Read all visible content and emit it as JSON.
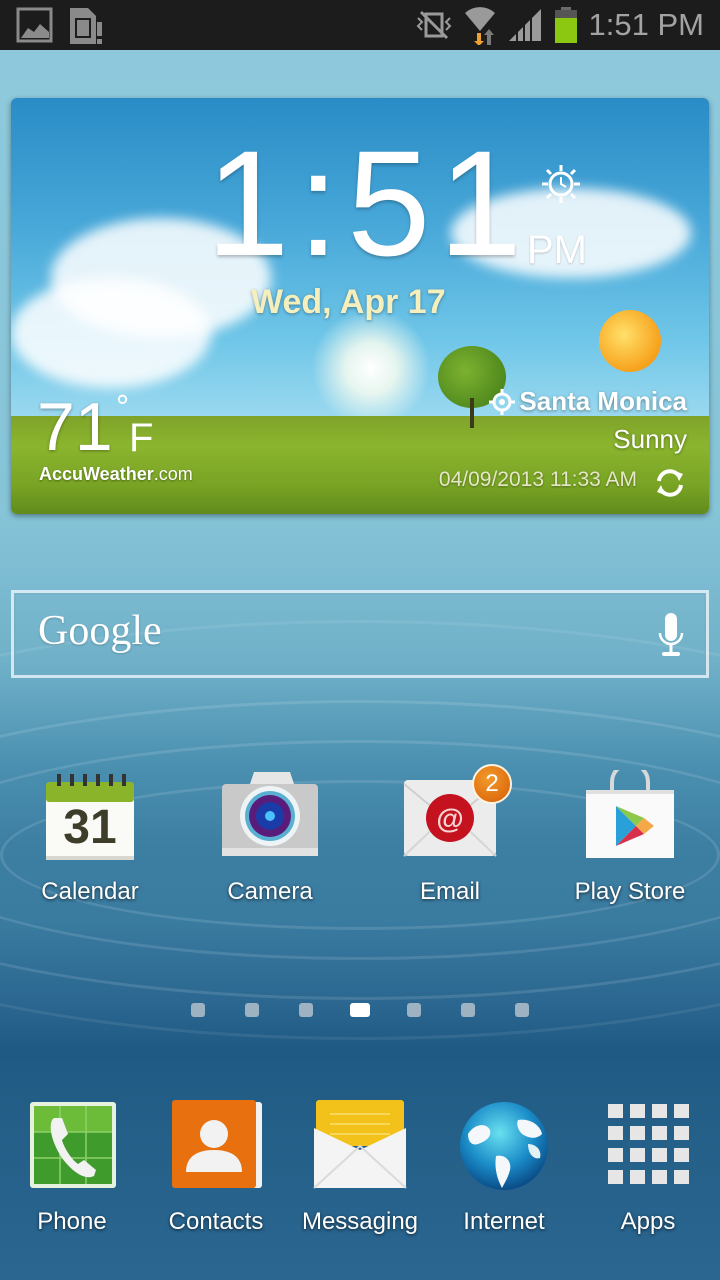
{
  "status_bar": {
    "left_icons": [
      "gallery-notification-icon",
      "sd-card-warning-icon"
    ],
    "right_icons": [
      "vibrate-mute-icon",
      "wifi-icon",
      "signal-icon",
      "battery-icon"
    ],
    "time": "1:51 PM",
    "battery_color": "#8cc812"
  },
  "weather_widget": {
    "clock": "1:51",
    "ampm": "PM",
    "date": "Wed, Apr 17",
    "temperature": "71",
    "degree_symbol": "°",
    "unit": "F",
    "provider_brand": "AccuWeather",
    "provider_suffix": ".com",
    "location": "Santa Monica",
    "condition": "Sunny",
    "last_updated": "04/09/2013 11:33 AM"
  },
  "search_bar": {
    "logo_text": "Google"
  },
  "home_apps": [
    {
      "label": "Calendar",
      "icon": "calendar-icon",
      "day": "31"
    },
    {
      "label": "Camera",
      "icon": "camera-icon"
    },
    {
      "label": "Email",
      "icon": "email-icon",
      "badge": "2"
    },
    {
      "label": "Play Store",
      "icon": "play-store-icon"
    }
  ],
  "page_indicator": {
    "total": 7,
    "active_index": 3
  },
  "dock": [
    {
      "label": "Phone",
      "icon": "phone-icon"
    },
    {
      "label": "Contacts",
      "icon": "contacts-icon"
    },
    {
      "label": "Messaging",
      "icon": "messaging-icon"
    },
    {
      "label": "Internet",
      "icon": "internet-globe-icon"
    },
    {
      "label": "Apps",
      "icon": "apps-grid-icon"
    }
  ]
}
